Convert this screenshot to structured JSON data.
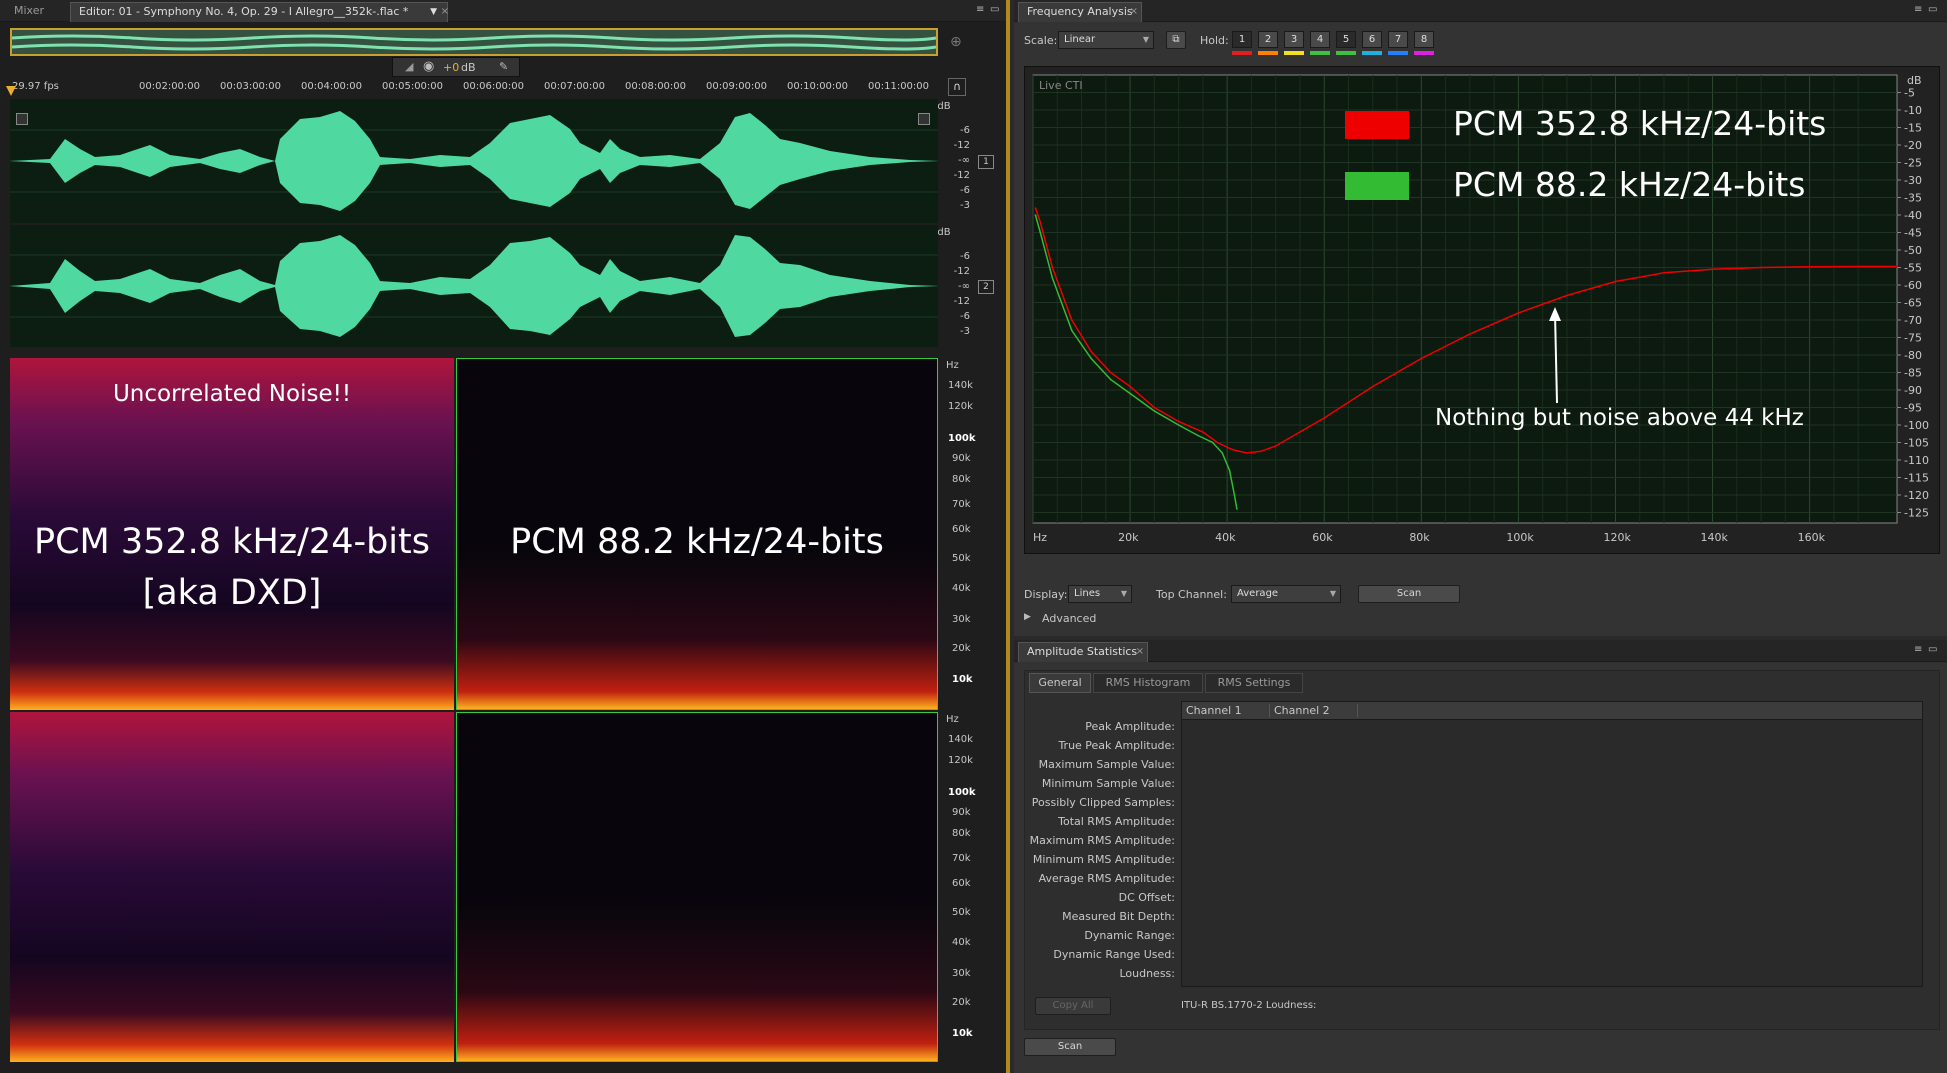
{
  "editor": {
    "tabs": {
      "mixer": "Mixer",
      "editor": "Editor: 01 - Symphony No. 4, Op. 29  - I Allegro__352k-.flac *"
    },
    "gain_value": "+0",
    "gain_unit": "dB",
    "ruler": {
      "fps": "29.97 fps",
      "ticks": [
        "00:02:00:00",
        "00:03:00:00",
        "00:04:00:00",
        "00:05:00:00",
        "00:06:00:00",
        "00:07:00:00",
        "00:08:00:00",
        "00:09:00:00",
        "00:10:00:00",
        "00:11:00:00"
      ]
    },
    "waveform_scale": [
      "dB",
      "-6",
      "-12",
      "-∞",
      "-12",
      "-6",
      "-3"
    ],
    "channel1": "1",
    "channel2": "2",
    "spectral_scale": [
      "Hz",
      "140k",
      "120k",
      "100k",
      "90k",
      "80k",
      "70k",
      "60k",
      "50k",
      "40k",
      "30k",
      "20k",
      "10k"
    ],
    "overlay": {
      "uncorrelated": "Uncorrelated Noise!!",
      "left_line1": "PCM 352.8 kHz/24-bits",
      "left_line2": "[aka DXD]",
      "right": "PCM 88.2 kHz/24-bits"
    }
  },
  "freq": {
    "tab": "Frequency Analysis",
    "scale_label": "Scale:",
    "scale_value": "Linear",
    "hold_label": "Hold:",
    "hold_buttons": [
      "1",
      "2",
      "3",
      "4",
      "5",
      "6",
      "7",
      "8"
    ],
    "hold_colors": [
      "#e02020",
      "#ff8000",
      "#f0e020",
      "#40c040",
      "#40c040",
      "#20b0e0",
      "#2080ff",
      "#e020e0"
    ],
    "live_cti": "Live CTI",
    "legend": [
      {
        "label": "PCM 352.8 kHz/24-bits",
        "color": "#ee0000"
      },
      {
        "label": "PCM 88.2 kHz/24-bits",
        "color": "#33bb33"
      }
    ],
    "annotation": "Nothing but noise above 44 kHz",
    "y_unit": "dB",
    "y_ticks": [
      "-5",
      "-10",
      "-15",
      "-20",
      "-25",
      "-30",
      "-35",
      "-40",
      "-45",
      "-50",
      "-55",
      "-60",
      "-65",
      "-70",
      "-75",
      "-80",
      "-85",
      "-90",
      "-95",
      "-100",
      "-105",
      "-110",
      "-115",
      "-120",
      "-125"
    ],
    "x_ticks": [
      "Hz",
      "20k",
      "40k",
      "60k",
      "80k",
      "100k",
      "120k",
      "140k",
      "160k"
    ],
    "display_label": "Display:",
    "display_value": "Lines",
    "top_channel_label": "Top Channel:",
    "top_channel_value": "Average",
    "scan": "Scan",
    "advanced": "Advanced"
  },
  "chart_data": {
    "type": "line",
    "xlabel": "Hz",
    "ylabel": "dB",
    "xlim": [
      0,
      178000
    ],
    "ylim": [
      -128,
      0
    ],
    "series": [
      {
        "name": "PCM 352.8 kHz/24-bits",
        "color": "#ee0000",
        "x": [
          500,
          1500,
          4000,
          8000,
          12000,
          16000,
          20000,
          25000,
          30000,
          35000,
          38000,
          41000,
          44000,
          47000,
          50000,
          60000,
          70000,
          80000,
          90000,
          100000,
          110000,
          120000,
          130000,
          140000,
          150000,
          160000,
          170000,
          178000
        ],
        "y": [
          -38,
          -42,
          -55,
          -70,
          -79,
          -85,
          -89,
          -95,
          -99,
          -102,
          -105,
          -107,
          -108,
          -107.5,
          -106,
          -98,
          -89,
          -81,
          -74,
          -68,
          -63,
          -59,
          -56.5,
          -55.5,
          -55,
          -54.8,
          -54.7,
          -54.7
        ]
      },
      {
        "name": "PCM 88.2 kHz/24-bits",
        "color": "#33bb33",
        "x": [
          500,
          1500,
          4000,
          8000,
          12000,
          16000,
          20000,
          25000,
          30000,
          34000,
          37000,
          39000,
          40500,
          41500,
          42000
        ],
        "y": [
          -40,
          -45,
          -58,
          -73,
          -81,
          -87,
          -91,
          -96,
          -100,
          -103,
          -105,
          -108,
          -113,
          -120,
          -124
        ]
      }
    ]
  },
  "amp": {
    "tab": "Amplitude Statistics",
    "subtabs": [
      "General",
      "RMS Histogram",
      "RMS Settings"
    ],
    "columns": [
      "Channel 1",
      "Channel 2"
    ],
    "rows": [
      "Peak Amplitude:",
      "True Peak Amplitude:",
      "Maximum Sample Value:",
      "Minimum Sample Value:",
      "Possibly Clipped Samples:",
      "Total RMS Amplitude:",
      "Maximum RMS Amplitude:",
      "Minimum RMS Amplitude:",
      "Average RMS Amplitude:",
      "DC Offset:",
      "Measured Bit Depth:",
      "Dynamic Range:",
      "Dynamic Range Used:",
      "Loudness:"
    ],
    "copy_all": "Copy All",
    "itu": "ITU-R BS.1770-2 Loudness:",
    "scan": "Scan"
  }
}
